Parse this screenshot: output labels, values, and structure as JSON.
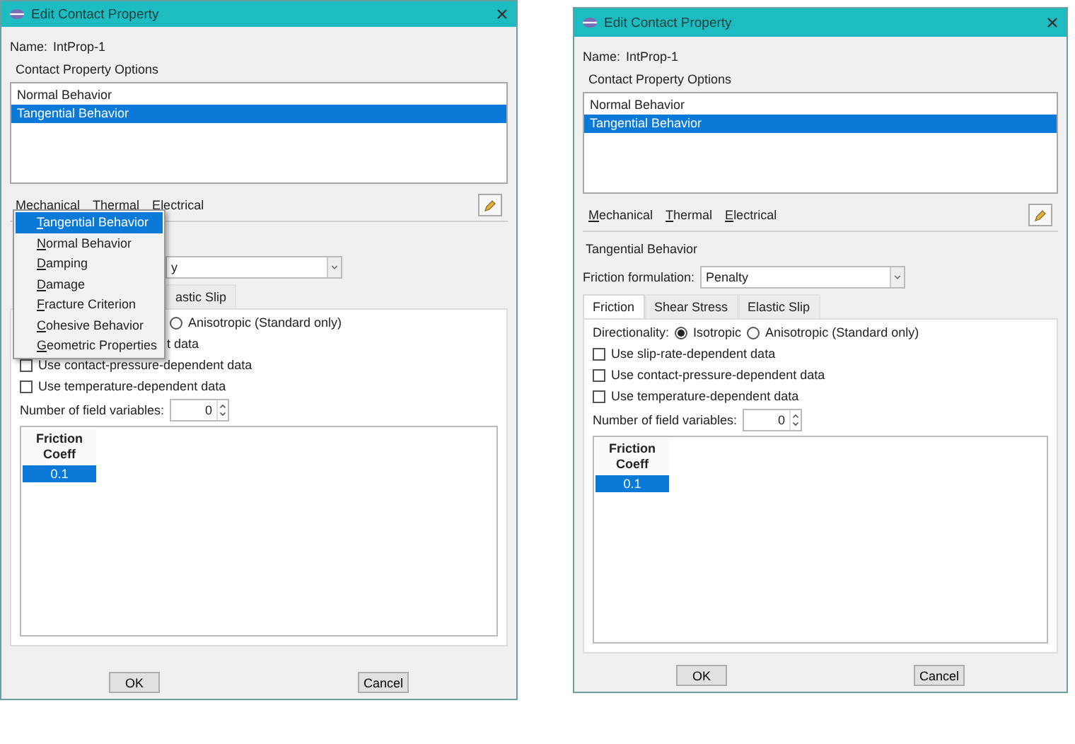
{
  "dialogs": [
    {
      "title": "Edit Contact Property",
      "name_label": "Name:",
      "name_value": "IntProp-1",
      "options_label": "Contact Property Options",
      "options": [
        {
          "label": "Normal Behavior",
          "selected": false
        },
        {
          "label": "Tangential Behavior",
          "selected": true
        }
      ],
      "menu_tabs": [
        "Mechanical",
        "Thermal",
        "Electrical"
      ],
      "popup_menu": [
        {
          "label": "Tangential Behavior",
          "selected": true
        },
        {
          "label": "Normal Behavior",
          "selected": false
        },
        {
          "label": "Damping",
          "selected": false
        },
        {
          "label": "Damage",
          "selected": false
        },
        {
          "label": "Fracture Criterion",
          "selected": false
        },
        {
          "label": "Cohesive Behavior",
          "selected": false
        },
        {
          "label": "Geometric Properties",
          "selected": false
        }
      ],
      "formulation_value": "y",
      "tabs": [
        {
          "label": "astic Slip",
          "selected": false
        }
      ],
      "radios": [
        {
          "label": "Anisotropic (Standard only)",
          "selected": false
        }
      ],
      "checkboxes": [
        {
          "label": "t data"
        },
        {
          "label": "Use contact-pressure-dependent data",
          "checked": false
        },
        {
          "label": "Use temperature-dependent data",
          "checked": false
        }
      ],
      "field_variables_label": "Number of field variables:",
      "field_variables_value": "0",
      "table": {
        "header": "Friction Coeff",
        "cells": [
          {
            "value": "0.1",
            "selected": true
          }
        ]
      },
      "buttons": [
        "OK",
        "Cancel"
      ]
    },
    {
      "title": "Edit Contact Property",
      "name_label": "Name:",
      "name_value": "IntProp-1",
      "options_label": "Contact Property Options",
      "options": [
        {
          "label": "Normal Behavior",
          "selected": false
        },
        {
          "label": "Tangential Behavior",
          "selected": true
        }
      ],
      "menu_tabs": [
        "Mechanical",
        "Thermal",
        "Electrical"
      ],
      "section_title": "Tangential Behavior",
      "formulation_label": "Friction formulation:",
      "formulation_value": "Penalty",
      "tabs": [
        {
          "label": "Friction",
          "selected": true
        },
        {
          "label": "Shear Stress",
          "selected": false
        },
        {
          "label": "Elastic Slip",
          "selected": false
        }
      ],
      "directionality_label": "Directionality:",
      "radios": [
        {
          "label": "Isotropic",
          "selected": true
        },
        {
          "label": "Anisotropic (Standard only)",
          "selected": false
        }
      ],
      "checkboxes": [
        {
          "label": "Use slip-rate-dependent data",
          "checked": false
        },
        {
          "label": "Use contact-pressure-dependent data",
          "checked": false
        },
        {
          "label": "Use temperature-dependent data",
          "checked": false
        }
      ],
      "field_variables_label": "Number of field variables:",
      "field_variables_value": "0",
      "table": {
        "header": "Friction Coeff",
        "cells": [
          {
            "value": "0.1",
            "selected": true
          }
        ]
      },
      "buttons": [
        "OK",
        "Cancel"
      ]
    }
  ]
}
